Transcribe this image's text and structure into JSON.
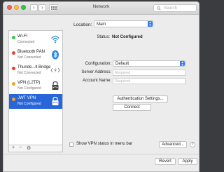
{
  "window": {
    "title": "Network"
  },
  "toolbar": {
    "back": "‹",
    "forward": "›",
    "search_placeholder": "Search"
  },
  "location": {
    "label": "Location:",
    "value": "Main"
  },
  "services": [
    {
      "name": "Wi-Fi",
      "status": "Connected",
      "dot_color": "#34c748",
      "icon": "wifi-icon"
    },
    {
      "name": "Bluetooth PAN",
      "status": "Not Connected",
      "dot_color": "#e0443a",
      "icon": "bluetooth-icon"
    },
    {
      "name": "Thunde...lt Bridge",
      "status": "Not Connected",
      "dot_color": "#e0443a",
      "icon": "thunderbolt-bridge-icon"
    },
    {
      "name": "VPN (L2TP)",
      "status": "Not Configured",
      "dot_color": "#f0a030",
      "icon": "vpn-lock-icon"
    },
    {
      "name": "JWT VPN",
      "status": "Not Configured",
      "dot_color": "#f0a030",
      "icon": "vpn-lock-icon"
    }
  ],
  "sidebar_bar": {
    "add": "+",
    "remove": "−",
    "gear": "⚙"
  },
  "detail": {
    "status_label": "Status:",
    "status_value": "Not Configured",
    "configuration_label": "Configuration:",
    "configuration_value": "Default",
    "server_label": "Server Address:",
    "server_placeholder": "Required",
    "account_label": "Account Name:",
    "account_placeholder": "Required",
    "auth_button": "Authentication Settings...",
    "connect_button": "Connect",
    "show_vpn_label": "Show VPN status in menu bar",
    "advanced_button": "Advanced...",
    "help": "?"
  },
  "footer": {
    "revert": "Revert",
    "apply": "Apply"
  },
  "colors": {
    "selection": "#2765d8",
    "accent": "#3a7ff2"
  }
}
